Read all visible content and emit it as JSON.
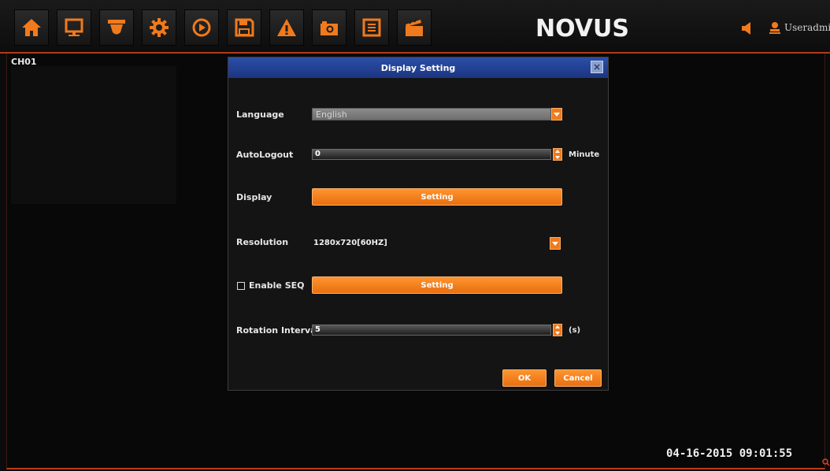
{
  "toolbar": {
    "icons": [
      "home-icon",
      "monitor-icon",
      "camera-dome-icon",
      "gear-icon",
      "play-icon",
      "save-icon",
      "warning-icon",
      "camera-icon",
      "list-icon",
      "clapper-icon"
    ],
    "accent": "#f07a1c"
  },
  "brand": {
    "logo_text": "NOVUS"
  },
  "status": {
    "username": "Useradmi"
  },
  "channel": {
    "label": "CH01"
  },
  "datetime": "04-16-2015 09:01:55",
  "dialog": {
    "title": "Display Setting",
    "close_label": "×",
    "language": {
      "label": "Language",
      "value": "English"
    },
    "autologout": {
      "label": "AutoLogout",
      "value": "0",
      "unit": "Minute"
    },
    "display": {
      "label": "Display",
      "button": "Setting"
    },
    "resolution": {
      "label": "Resolution",
      "value": "1280x720[60HZ]"
    },
    "seq": {
      "label": "Enable SEQ",
      "checked": false,
      "button": "Setting"
    },
    "rotation": {
      "label": "Rotation Interval",
      "value": "5",
      "unit": "(s)"
    },
    "ok": "OK",
    "cancel": "Cancel"
  }
}
